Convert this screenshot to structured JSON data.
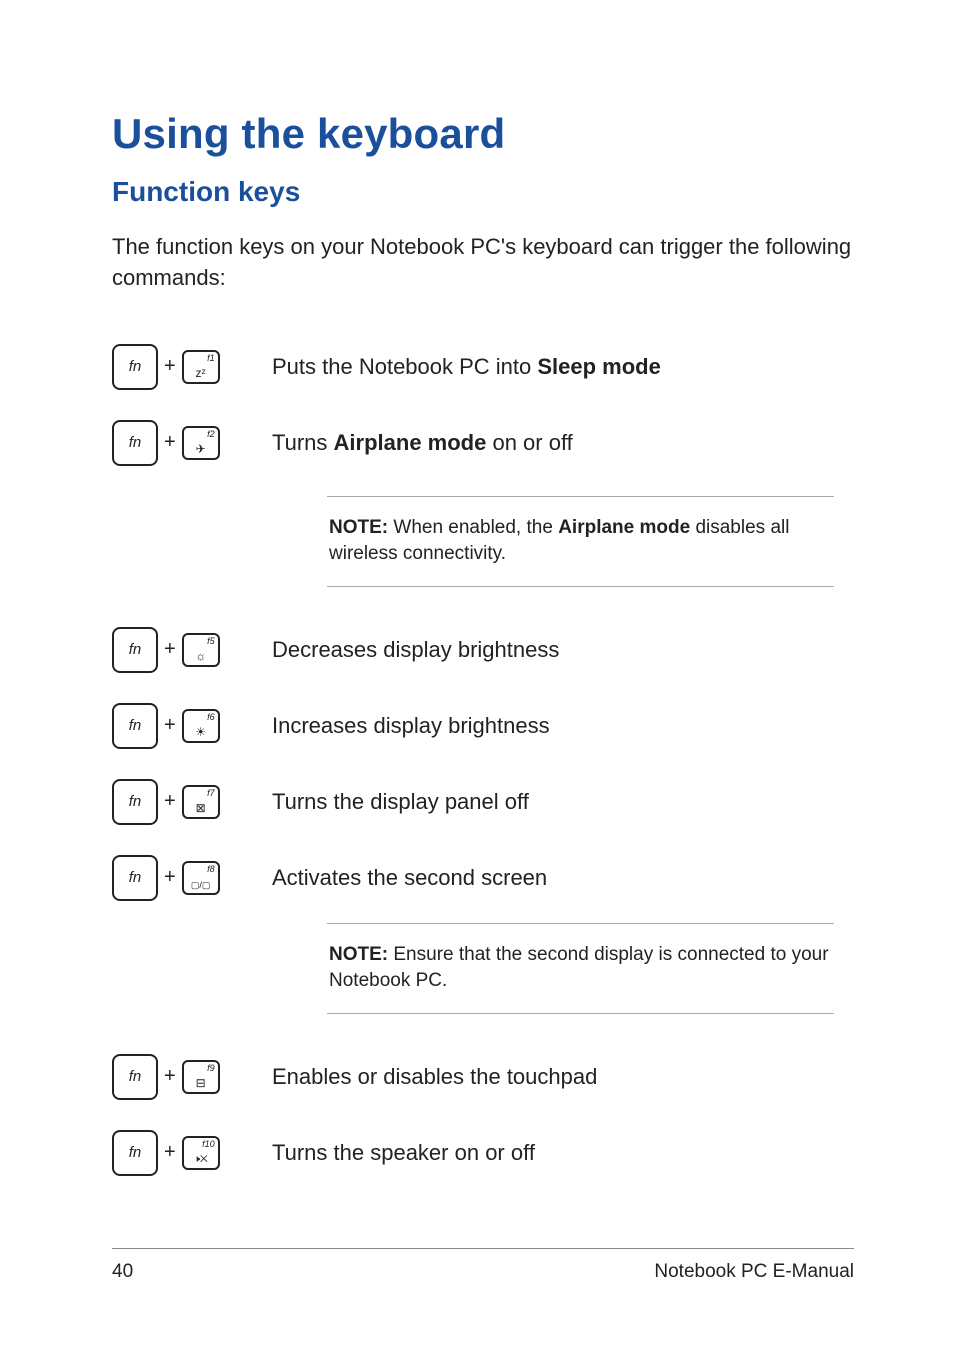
{
  "heading": "Using the keyboard",
  "subheading": "Function keys",
  "intro": "The function keys on your Notebook PC's keyboard can trigger the following commands:",
  "fn_label": "fn",
  "rows": {
    "f1": {
      "flabel": "f1",
      "glyph": "zᶻ",
      "desc_pre": "Puts the Notebook PC into ",
      "desc_bold": "Sleep mode",
      "desc_post": ""
    },
    "f2": {
      "flabel": "f2",
      "glyph": "✈",
      "desc_pre": "Turns ",
      "desc_bold": "Airplane mode",
      "desc_post": " on or off"
    },
    "f5": {
      "flabel": "f5",
      "glyph": "☼",
      "desc": "Decreases display brightness"
    },
    "f6": {
      "flabel": "f6",
      "glyph": "☀",
      "desc": "Increases display brightness"
    },
    "f7": {
      "flabel": "f7",
      "glyph": "⊠",
      "desc": "Turns the display panel off"
    },
    "f8": {
      "flabel": "f8",
      "glyph": "▢/▢",
      "desc": "Activates the second screen"
    },
    "f9": {
      "flabel": "f9",
      "glyph": "⊟",
      "desc": "Enables or disables the touchpad"
    },
    "f10": {
      "flabel": "f10",
      "glyph": "🕨✕",
      "desc": "Turns the speaker on or off"
    }
  },
  "note1": {
    "label": "NOTE:",
    "text_pre": " When enabled, the ",
    "text_bold": "Airplane mode",
    "text_post": " disables all wireless connectivity."
  },
  "note2": {
    "label": "NOTE:",
    "text": " Ensure that the second display is connected to your Notebook PC."
  },
  "footer": {
    "page": "40",
    "title": "Notebook PC E-Manual"
  }
}
